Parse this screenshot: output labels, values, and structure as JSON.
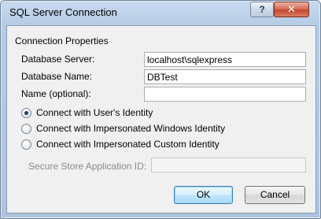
{
  "window": {
    "title": "SQL Server Connection",
    "help_glyph": "?",
    "close_glyph": "✕"
  },
  "group": {
    "title": "Connection Properties"
  },
  "fields": {
    "database_server": {
      "label": "Database Server:",
      "value": "localhost\\sqlexpress"
    },
    "database_name": {
      "label": "Database Name:",
      "value": "DBTest"
    },
    "name": {
      "label": "Name (optional):",
      "value": ""
    }
  },
  "identity_options": [
    {
      "label": "Connect with User's Identity",
      "checked": true
    },
    {
      "label": "Connect with Impersonated Windows Identity",
      "checked": false
    },
    {
      "label": "Connect with Impersonated Custom Identity",
      "checked": false
    }
  ],
  "secure_store": {
    "label": "Secure Store Application ID:",
    "value": ""
  },
  "buttons": {
    "ok": "OK",
    "cancel": "Cancel"
  }
}
